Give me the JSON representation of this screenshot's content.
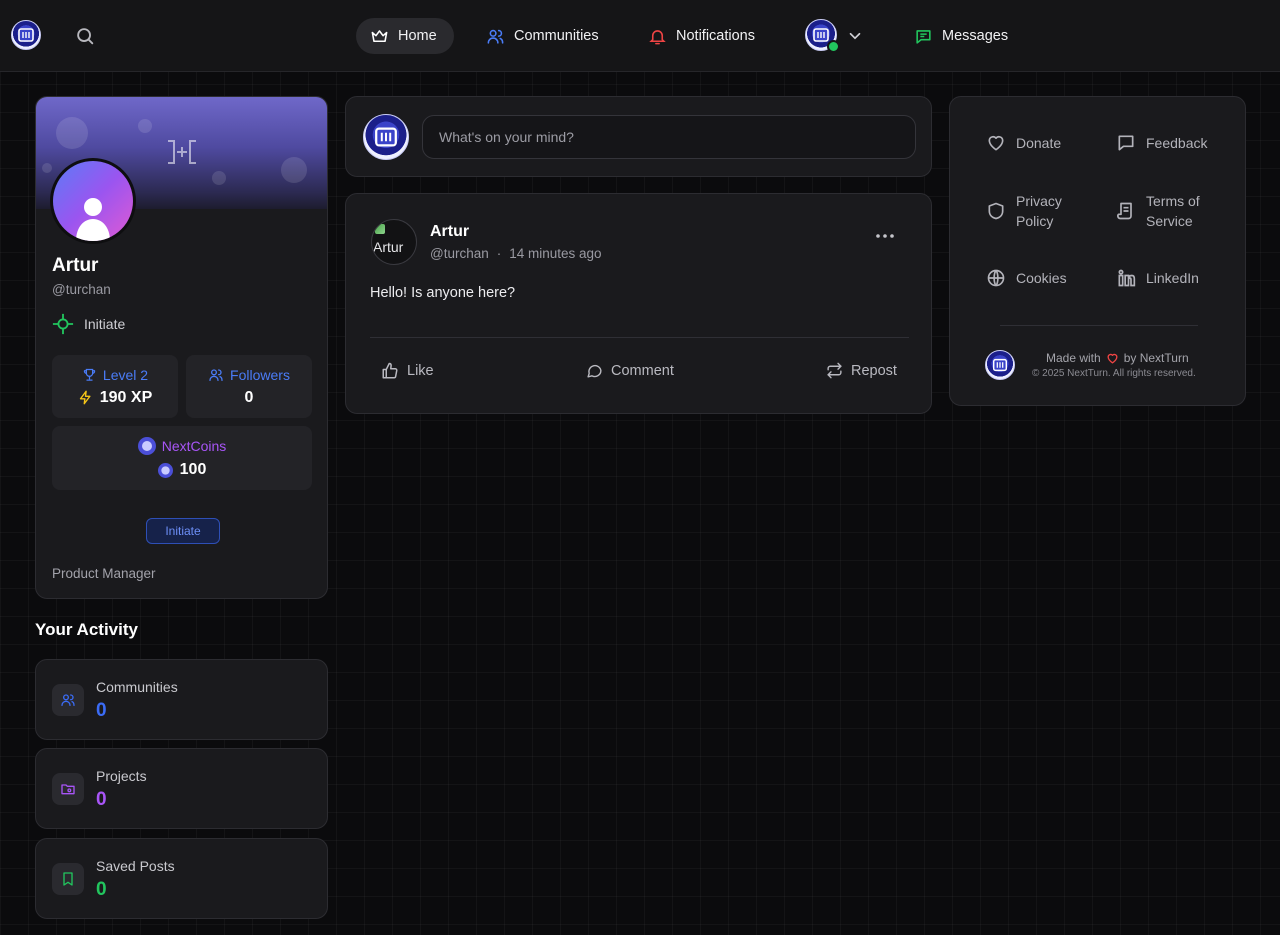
{
  "colors": {
    "accent_blue": "#4a7cf7",
    "accent_purple": "#a855f7",
    "accent_green": "#22c55e",
    "accent_red": "#ef4444",
    "yellow": "#f5c518"
  },
  "nav": {
    "home": "Home",
    "communities": "Communities",
    "notifications": "Notifications",
    "messages": "Messages"
  },
  "profile": {
    "name": "Artur",
    "handle": "@turchan",
    "rank": "Initiate",
    "level_label": "Level 2",
    "xp": "190 XP",
    "followers_label": "Followers",
    "followers": "0",
    "coins_label": "NextCoins",
    "coins": "100",
    "badge": "Initiate",
    "job": "Product Manager"
  },
  "activity": {
    "title": "Your Activity",
    "items": [
      {
        "label": "Communities",
        "value": "0",
        "color": "#3b6cf6",
        "icon": "users-icon"
      },
      {
        "label": "Projects",
        "value": "0",
        "color": "#a855f7",
        "icon": "folder-icon"
      },
      {
        "label": "Saved Posts",
        "value": "0",
        "color": "#22c55e",
        "icon": "bookmark-icon"
      }
    ]
  },
  "composer": {
    "placeholder": "What's on your mind?"
  },
  "post": {
    "avatar_alt": "Artur",
    "author": "Artur",
    "handle": "@turchan",
    "dot": "·",
    "time": "14 minutes ago",
    "text": "Hello! Is anyone here?",
    "like": "Like",
    "comment": "Comment",
    "repost": "Repost"
  },
  "side": {
    "donate": "Donate",
    "feedback": "Feedback",
    "privacy_1": "Privacy",
    "privacy_2": "Policy",
    "terms_1": "Terms of",
    "terms_2": "Service",
    "cookies": "Cookies",
    "linkedin": "LinkedIn",
    "made_with": "Made with",
    "by": "by NextTurn",
    "copyright": "© 2025 NextTurn. All rights reserved."
  }
}
